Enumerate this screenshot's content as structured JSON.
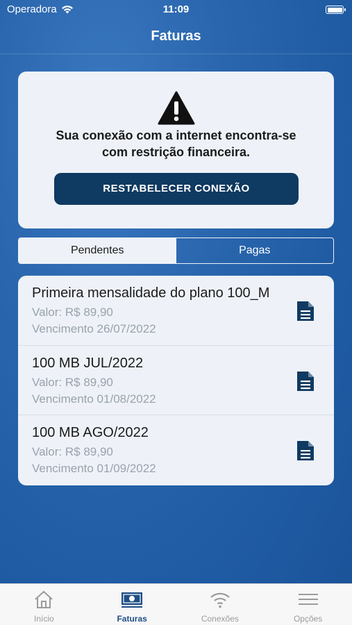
{
  "status": {
    "carrier": "Operadora",
    "time": "11:09"
  },
  "nav": {
    "title": "Faturas"
  },
  "alert": {
    "icon": "warning-icon",
    "line1": "Sua conexão com a internet encontra-se",
    "line2": "com restrição financeira.",
    "button_label": "RESTABELECER CONEXÃO"
  },
  "tabs": {
    "pending": "Pendentes",
    "paid": "Pagas"
  },
  "invoices": [
    {
      "title": "Primeira mensalidade do plano 100_M",
      "value": "Valor: R$ 89,90",
      "due": "Vencimento 26/07/2022"
    },
    {
      "title": "100 MB JUL/2022",
      "value": "Valor: R$ 89,90",
      "due": "Vencimento 01/08/2022"
    },
    {
      "title": "100 MB AGO/2022",
      "value": "Valor: R$ 89,90",
      "due": "Vencimento 01/09/2022"
    }
  ],
  "tabbar": {
    "items": [
      {
        "label": "Início",
        "icon": "home-icon"
      },
      {
        "label": "Faturas",
        "icon": "invoice-icon"
      },
      {
        "label": "Conexões",
        "icon": "wifi-icon"
      },
      {
        "label": "Opções",
        "icon": "menu-icon"
      }
    ],
    "active_color": "#1f4f86",
    "inactive_color": "#9b9b9b"
  },
  "colors": {
    "primary": "#0f3a61",
    "background": "#2a66ad",
    "card": "#eef2f8"
  }
}
